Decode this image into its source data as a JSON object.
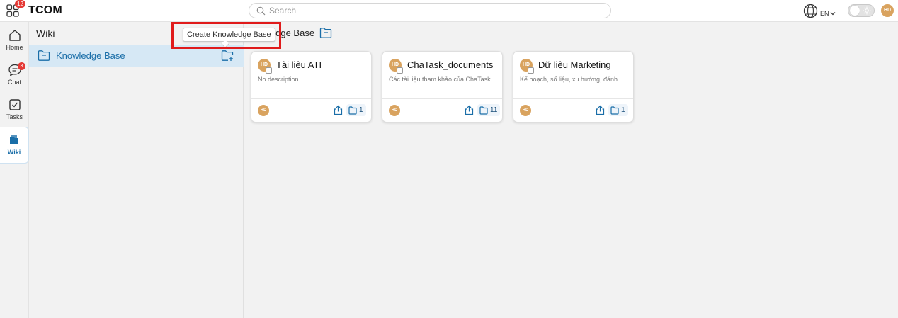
{
  "app": {
    "brand": "TCOM",
    "apps_badge": "12"
  },
  "search": {
    "placeholder": "Search"
  },
  "header": {
    "language": "EN",
    "avatar_initials": "HD"
  },
  "rail": {
    "items": [
      {
        "label": "Home",
        "icon": "home-icon"
      },
      {
        "label": "Chat",
        "icon": "chat-icon",
        "badge": "3"
      },
      {
        "label": "Tasks",
        "icon": "tasks-icon"
      },
      {
        "label": "Wiki",
        "icon": "wiki-icon",
        "active": true
      }
    ]
  },
  "wiki_panel": {
    "title": "Wiki",
    "items": [
      {
        "label": "Knowledge Base"
      }
    ]
  },
  "tooltip": {
    "text": "Create Knowledge Base"
  },
  "main": {
    "title": "Knowledge Base",
    "title_visible_fragment": "ledge Base",
    "cards": [
      {
        "title": "Tài liệu ATI",
        "description": "No description",
        "owner_initials": "HD",
        "doc_count": "1"
      },
      {
        "title": "ChaTask_documents",
        "description": "Các tài liệu tham khảo của ChaTask",
        "owner_initials": "HD",
        "doc_count": "11"
      },
      {
        "title": "Dữ liệu Marketing",
        "description": "Kế hoạch, số liệu, xu hướng, đánh giá...",
        "owner_initials": "HD",
        "doc_count": "1"
      }
    ]
  },
  "colors": {
    "accent": "#1a6ea8",
    "selected_row": "#d6e8f5",
    "badge": "#e53935",
    "avatar": "#d9a35f",
    "highlight": "#e01b1b"
  }
}
